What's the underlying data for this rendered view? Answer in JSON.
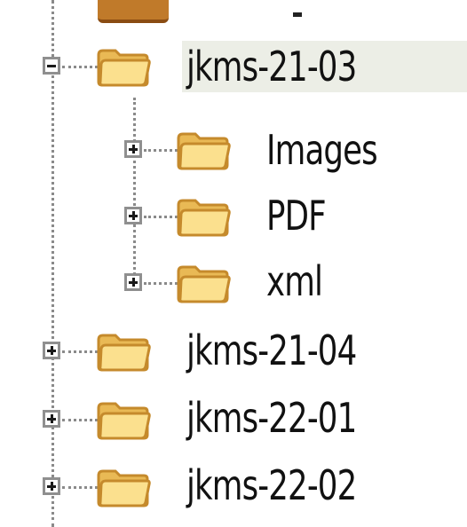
{
  "tree": {
    "items": [
      {
        "label": "jkms-21-03",
        "expanded": true,
        "selected": true,
        "level": 0
      },
      {
        "label": "Images",
        "expanded": false,
        "level": 1
      },
      {
        "label": "PDF",
        "expanded": false,
        "level": 1
      },
      {
        "label": "xml",
        "expanded": false,
        "level": 1
      },
      {
        "label": "jkms-21-04",
        "expanded": false,
        "level": 0
      },
      {
        "label": "jkms-22-01",
        "expanded": false,
        "level": 0
      },
      {
        "label": "jkms-22-02",
        "expanded": false,
        "level": 0
      }
    ]
  },
  "colors": {
    "folder_fill": "#f6d47a",
    "folder_edge": "#c58a2c",
    "selection": "#eceee6",
    "tree_line": "#8a8a8a"
  },
  "icons": {
    "folder": "folder-icon",
    "expand": "plus-icon",
    "collapse": "minus-icon"
  }
}
